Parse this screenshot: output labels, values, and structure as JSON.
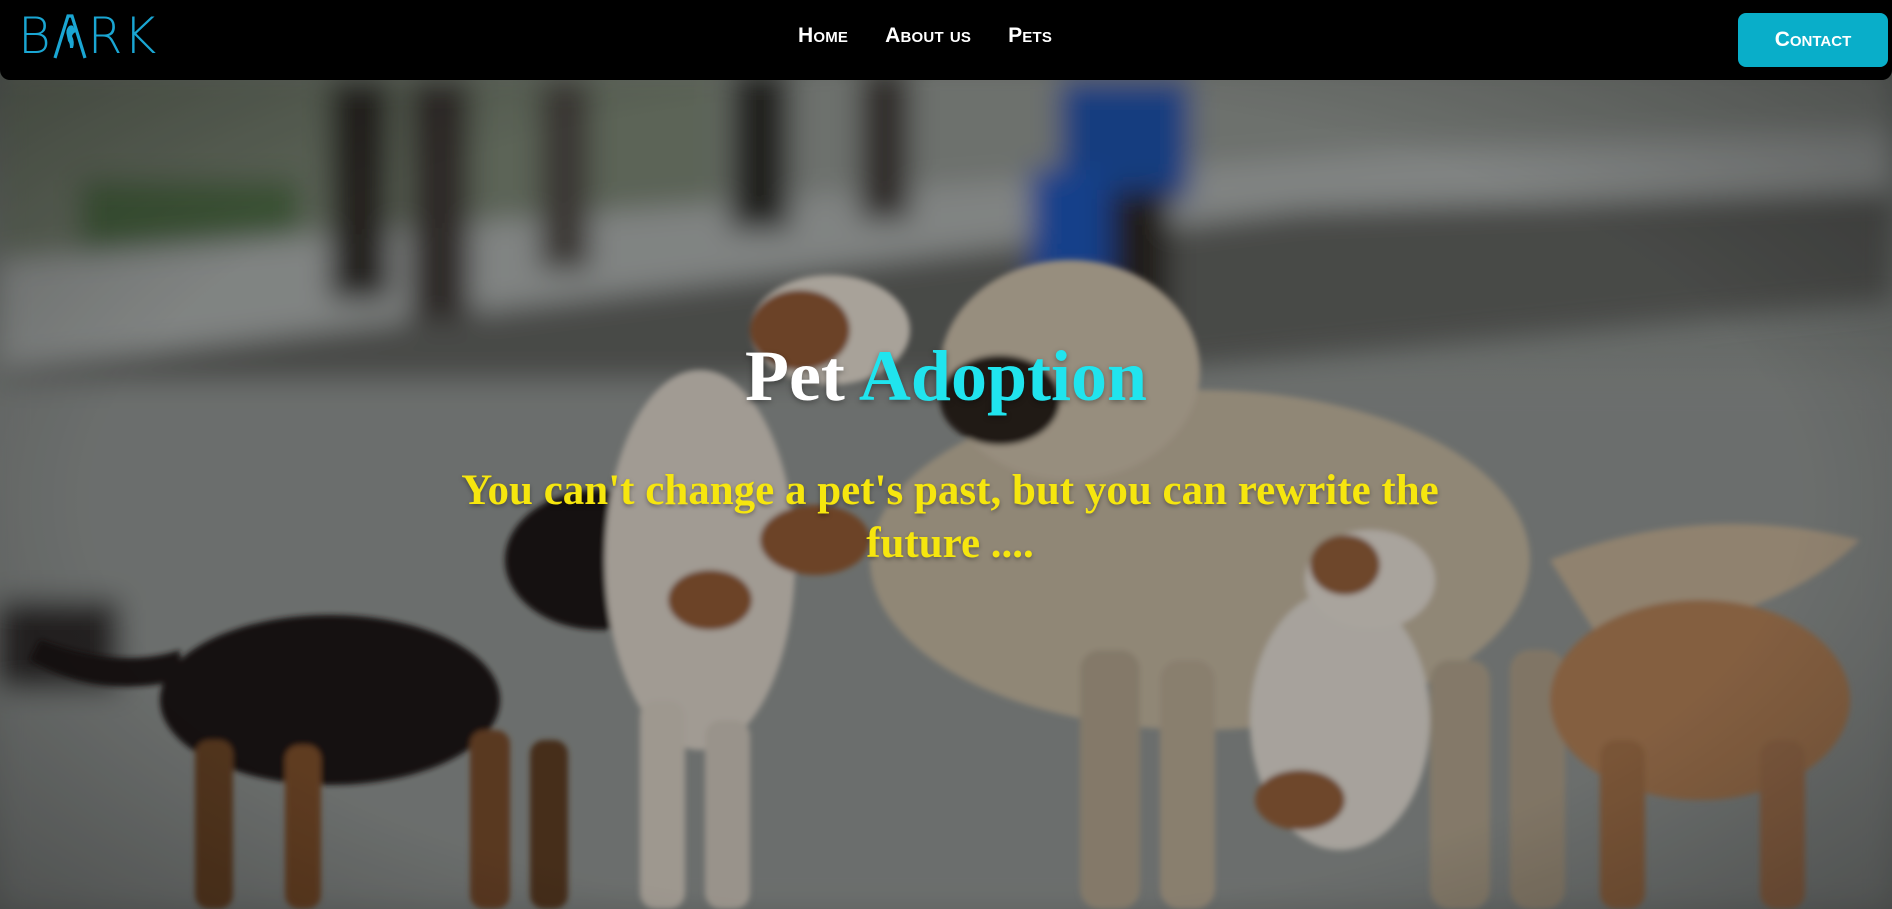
{
  "brand": {
    "logo_text_left": "B",
    "logo_text_right": "RK",
    "logo_color": "#1aa6d3"
  },
  "nav": {
    "items": [
      {
        "label": "Home"
      },
      {
        "label": "About us"
      },
      {
        "label": "Pets"
      }
    ],
    "contact_label": "Contact",
    "contact_color": "#09aec9"
  },
  "hero": {
    "title_part1": "Pet",
    "title_part2": "Adoption",
    "title_accent_color": "#20e4ee",
    "subtitle": "You can't change a pet's past, but you can rewrite the future ....",
    "subtitle_color": "#f6e60e",
    "background_image": "dogs-on-street-photo"
  }
}
